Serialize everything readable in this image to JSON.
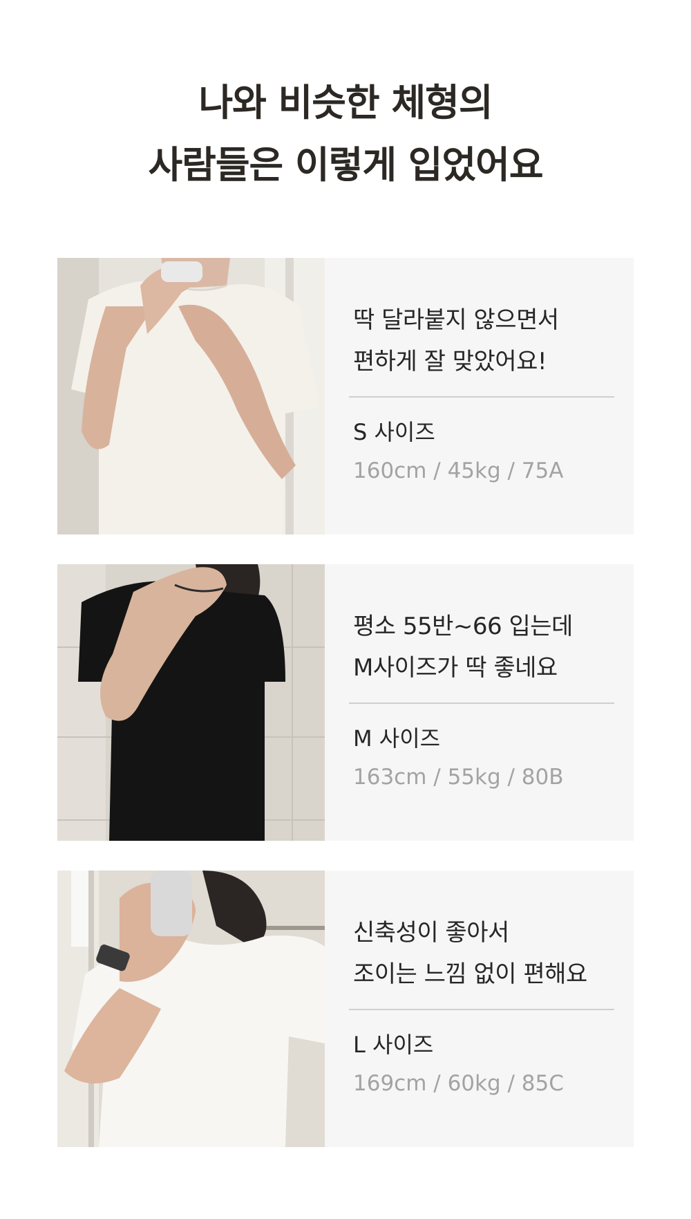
{
  "header": {
    "title_line1": "나와 비슷한 체형의",
    "title_line2": "사람들은 이렇게 입었어요"
  },
  "reviews": [
    {
      "comment_line1": "딱 달라붙지 않으면서",
      "comment_line2": "편하게 잘 맞았어요!",
      "size": "S 사이즈",
      "measurements": "160cm / 45kg / 75A"
    },
    {
      "comment_line1": "평소 55반~66 입는데",
      "comment_line2": "M사이즈가 딱 좋네요",
      "size": "M 사이즈",
      "measurements": "163cm / 55kg / 80B"
    },
    {
      "comment_line1": "신축성이 좋아서",
      "comment_line2": "조이는 느낌 없이 편해요",
      "size": "L 사이즈",
      "measurements": "169cm / 60kg / 85C"
    }
  ]
}
